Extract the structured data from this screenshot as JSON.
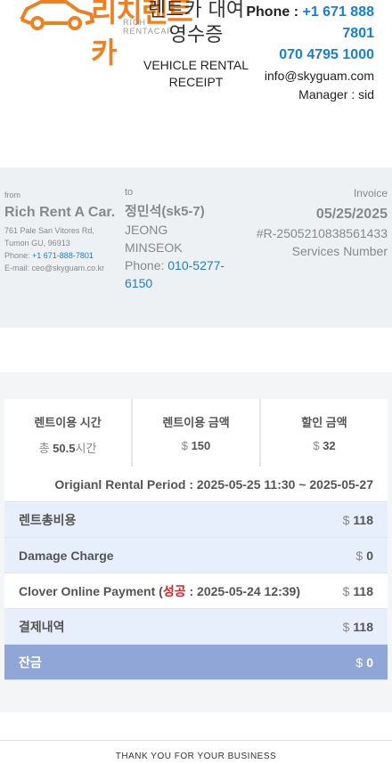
{
  "header": {
    "logo_text": "리치렌트카",
    "logo_sub": "RICH RENTACAR",
    "title_ko": "렌트카 대여 영수증",
    "title_en": "VEHICLE RENTAL RECEIPT",
    "phone_label": "Phone : ",
    "phone_intl": "+1 671 888 7801",
    "phone_local": "070 4795 1000",
    "email": "info@skyguam.com",
    "manager": "Manager : sid"
  },
  "from": {
    "label": "from",
    "name": "Rich Rent A Car.",
    "address_line1": "761 Pale San Vitores Rd,",
    "address_line2": "Tumon GU, 96913",
    "phone_label": "Phone: ",
    "phone": "+1 671-888-7801",
    "email_label": "E-mail: ",
    "email": "ceo@skyguam.co.kr"
  },
  "to": {
    "label": "to",
    "name": "정민석(sk5-7)",
    "name_en_1": "JEONG",
    "name_en_2": "MINSEOK",
    "phone_label": "Phone: ",
    "phone": "010-5277-6150"
  },
  "invoice": {
    "label": "Invoice",
    "date": "05/25/2025",
    "number": "#R-2505210838561433",
    "services_label": "Services Number"
  },
  "summary": [
    {
      "head": "렌트이용 시간",
      "prefix": "총 ",
      "value": "50.5",
      "suffix": "시간"
    },
    {
      "head": "렌트이용 금액",
      "prefix": "$ ",
      "value": "150",
      "suffix": ""
    },
    {
      "head": "할인 금액",
      "prefix": "$ ",
      "value": "32",
      "suffix": ""
    }
  ],
  "period": "Origianl Rental Period : 2025-05-25 11:30 ~ 2025-05-27",
  "rows": {
    "total_label": "렌트총비용",
    "total_amount": "118",
    "damage_label": "Damage Charge",
    "damage_amount": "0",
    "payment_label_pre": "Clover Online Payment (",
    "payment_status": "성공",
    "payment_label_post": " : 2025-05-24 12:39)",
    "payment_amount": "118",
    "paid_label": "결제내역",
    "paid_amount": "118",
    "balance_label": "잔금",
    "balance_amount": "0",
    "currency": "$"
  },
  "footer": {
    "text": "THANK YOU FOR YOUR BUSINESS"
  },
  "colors": {
    "brand_orange": "#f07f1f",
    "link_blue": "#1a7fd4",
    "balance_row": "#8fa6d6",
    "success_red": "#e02020"
  }
}
